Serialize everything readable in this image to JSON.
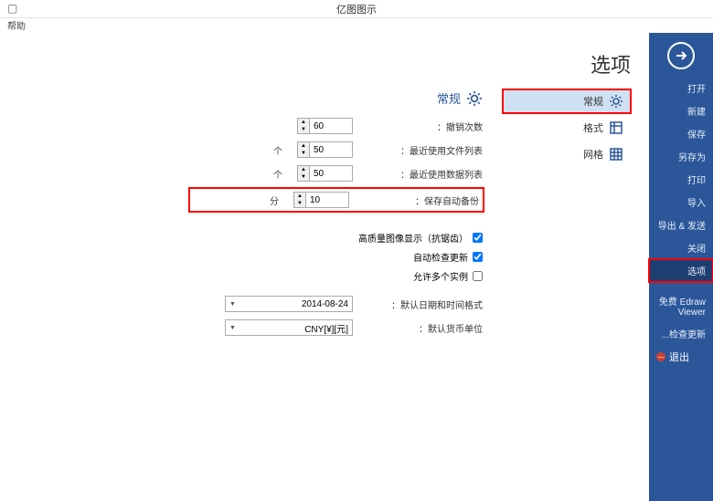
{
  "titlebar": {
    "title": "亿图图示",
    "minimize": "▢"
  },
  "helpbar": {
    "help": "帮助"
  },
  "sidebar": {
    "items": [
      {
        "label": "打开"
      },
      {
        "label": "新建"
      },
      {
        "label": "保存"
      },
      {
        "label": "另存为"
      },
      {
        "label": "打印"
      },
      {
        "label": "导入"
      },
      {
        "label": "导出 & 发送"
      },
      {
        "label": "关闭"
      },
      {
        "label": "选项",
        "selected": true
      },
      {
        "label": "免费 Edraw Viewer"
      },
      {
        "label": "检查更新..."
      },
      {
        "label": "退出"
      }
    ]
  },
  "page": {
    "title": "选项"
  },
  "categories": [
    {
      "label": "常规",
      "icon": "gear",
      "selected": true
    },
    {
      "label": "格式",
      "icon": "grid"
    },
    {
      "label": "网格",
      "icon": "grid2"
    }
  ],
  "section": {
    "title": "常规"
  },
  "form": {
    "undo": {
      "label": "撤销次数：",
      "value": "60",
      "unit": ""
    },
    "recent": {
      "label": "最近使用文件列表：",
      "value": "50",
      "unit": "个"
    },
    "recdisp": {
      "label": "最近使用数据列表：",
      "value": "50",
      "unit": "个"
    },
    "autosave": {
      "label": "保存自动备份：",
      "value": "10",
      "unit": "分"
    }
  },
  "checks": {
    "c1": {
      "label": "高质量图像显示（抗锯齿）",
      "checked": true
    },
    "c2": {
      "label": "自动检查更新",
      "checked": true
    },
    "c3": {
      "label": "允许多个实例",
      "checked": false
    }
  },
  "selects": {
    "date": {
      "label": "默认日期和时间格式：",
      "value": "2014-08-24"
    },
    "currency": {
      "label": "默认货币单位：",
      "value": "CNY[¥][元]"
    }
  }
}
